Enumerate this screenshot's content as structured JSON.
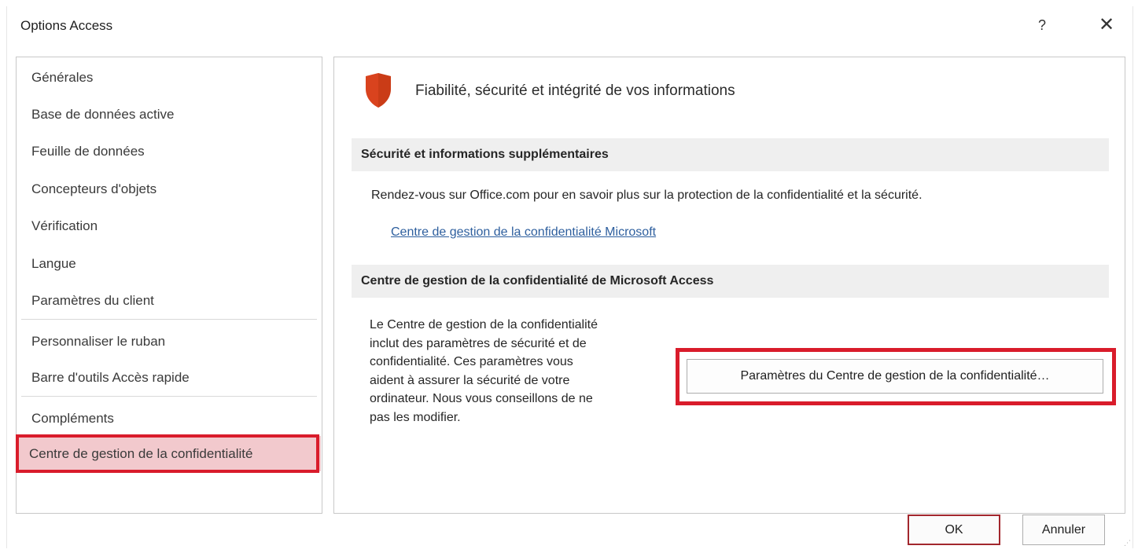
{
  "window": {
    "title": "Options Access",
    "help_label": "?",
    "close_label": "✕"
  },
  "nav": {
    "items": [
      {
        "label": "Générales"
      },
      {
        "label": "Base de données active"
      },
      {
        "label": "Feuille de données"
      },
      {
        "label": "Concepteurs d'objets"
      },
      {
        "label": "Vérification"
      },
      {
        "label": "Langue"
      },
      {
        "label": "Paramètres du client"
      },
      {
        "label": "Personnaliser le ruban"
      },
      {
        "label": "Barre d'outils Accès rapide"
      },
      {
        "label": "Compléments"
      },
      {
        "label": "Centre de gestion de la confidentialité",
        "selected": true
      }
    ],
    "highlight_color": "#d91c2b",
    "selected_bg": "#f2c9cd"
  },
  "content": {
    "icon": "shield-icon",
    "heading": "Fiabilité, sécurité et intégrité de vos informations",
    "section1": {
      "header": "Sécurité et informations supplémentaires",
      "text": "Rendez-vous sur Office.com pour en savoir plus sur la protection de la confidentialité et la sécurité.",
      "link": "Centre de gestion de la confidentialité Microsoft"
    },
    "section2": {
      "header": "Centre de gestion de la confidentialité de Microsoft Access",
      "description_lines": [
        "Le Centre de gestion de la confidentialité",
        "inclut des paramètres de sécurité et de",
        "confidentialité. Ces paramètres vous",
        "aident à assurer la sécurité de votre",
        "ordinateur. Nous vous conseillons de ne",
        "pas les modifier."
      ],
      "button_label": "Paramètres du Centre de gestion de la confidentialité…"
    }
  },
  "footer": {
    "ok_label": "OK",
    "cancel_label": "Annuler"
  },
  "colors": {
    "shield": "#d9431e",
    "link": "#2e5f9e",
    "ok_border": "#a2272d"
  }
}
